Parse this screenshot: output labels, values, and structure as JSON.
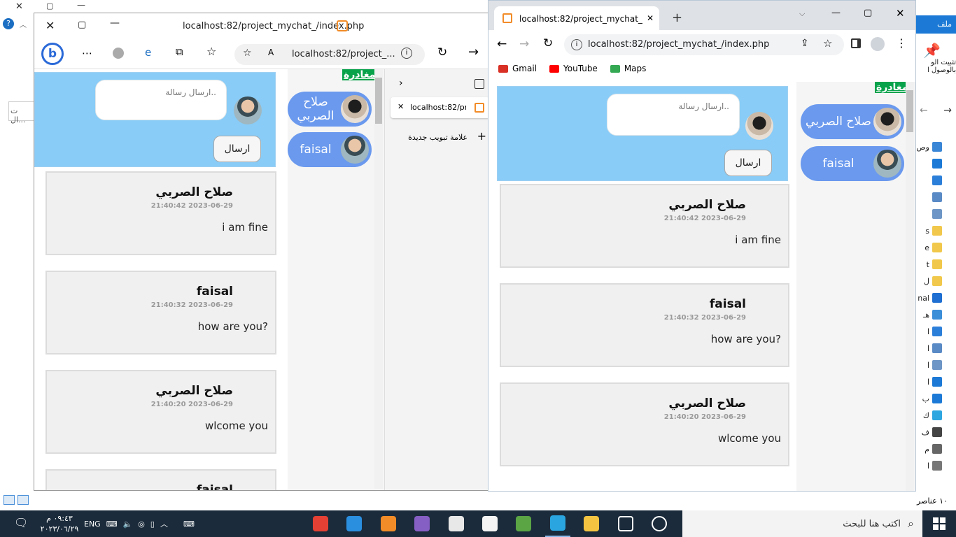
{
  "explorer": {
    "ribbon_label": "ملف",
    "pin_label_1": "تثبيت الو",
    "pin_label_2": "بالوصول ا",
    "search_text": "ت ال...",
    "help_glyph": "?",
    "items_count": "١٠ عناصر",
    "items": [
      {
        "label": "وص",
        "color": "#3a86d6"
      },
      {
        "label": "",
        "color": "#1c7ad6"
      },
      {
        "label": "",
        "color": "#2c7fd9"
      },
      {
        "label": "",
        "color": "#5a8ac5"
      },
      {
        "label": "",
        "color": "#6d95c5"
      },
      {
        "label": "s",
        "color": "#f1c84b"
      },
      {
        "label": "e",
        "color": "#f1c84b"
      },
      {
        "label": "t",
        "color": "#f1c84b"
      },
      {
        "label": "ل",
        "color": "#f1c84b"
      },
      {
        "label": "nal",
        "color": "#1e6fd1"
      },
      {
        "label": "هـ",
        "color": "#3b8ed8"
      },
      {
        "label": "ا",
        "color": "#2c7fd9"
      },
      {
        "label": "ا",
        "color": "#5a8ac5"
      },
      {
        "label": "ا",
        "color": "#6d95c5"
      },
      {
        "label": "ا",
        "color": "#1c7ad6"
      },
      {
        "label": "ب",
        "color": "#1c7ad6"
      },
      {
        "label": "ك",
        "color": "#2ea6e0"
      },
      {
        "label": "ف",
        "color": "#444444"
      },
      {
        "label": "م",
        "color": "#666666"
      },
      {
        "label": "ا",
        "color": "#777777"
      }
    ]
  },
  "taskbar": {
    "search_placeholder": "اكتب هنا للبحث",
    "clock_time": "٠٩:٤٣ م",
    "clock_date": "٢٠٢٣/٠٦/٢٩",
    "lang": "ENG",
    "apps": [
      {
        "name": "chrome",
        "color": "#e44134"
      },
      {
        "name": "vscode",
        "color": "#2b8fe0"
      },
      {
        "name": "xampp",
        "color": "#f28c28"
      },
      {
        "name": "visual-studio",
        "color": "#865fc5"
      },
      {
        "name": "mail",
        "color": "#e8e8e8"
      },
      {
        "name": "store",
        "color": "#f4f4f4"
      },
      {
        "name": "project",
        "color": "#5ba545"
      },
      {
        "name": "edge",
        "color": "#2aa5e0"
      },
      {
        "name": "file-explorer",
        "color": "#f5c542"
      },
      {
        "name": "task-view",
        "color": "#ffffff"
      },
      {
        "name": "cortana",
        "color": "#ffffff"
      }
    ]
  },
  "edge": {
    "tab_title": "localhost:82/project_mychat_/index.php",
    "address": "localhost:82/project_...",
    "vertical_tab_title": "localhost:82/pr",
    "new_tab_label": "علامة تبويب جديدة",
    "chat": {
      "placeholder": "ارسال رسالة..",
      "send_label": "ارسال",
      "leave_label": "مغادرة",
      "users": [
        {
          "name": "صلاح الصربي",
          "avatar": "dark"
        },
        {
          "name": "faisal",
          "avatar": "light"
        }
      ],
      "messages": [
        {
          "name": "صلاح الصربي",
          "time": "2023-06-29 21:40:42",
          "text": "i am fine"
        },
        {
          "name": "faisal",
          "time": "2023-06-29 21:40:32",
          "text": "how are you?"
        },
        {
          "name": "صلاح الصربي",
          "time": "2023-06-29 21:40:20",
          "text": "wlcome you"
        },
        {
          "name": "faisal",
          "time": "",
          "text": ""
        }
      ]
    }
  },
  "chrome": {
    "tab_title": "localhost:82/project_mychat_/ind",
    "address": "localhost:82/project_mychat_/index.php",
    "bookmarks": [
      {
        "label": "Gmail",
        "color": "#d93025"
      },
      {
        "label": "YouTube",
        "color": "#ff0000"
      },
      {
        "label": "Maps",
        "color": "#34a853"
      }
    ],
    "chat": {
      "placeholder": "ارسال رسالة..",
      "send_label": "ارسال",
      "leave_label": "مغادرة",
      "users": [
        {
          "name": "صلاح الصربي",
          "avatar": "dark"
        },
        {
          "name": "faisal",
          "avatar": "light"
        }
      ],
      "messages": [
        {
          "name": "صلاح الصربي",
          "time": "2023-06-29 21:40:42",
          "text": "i am fine"
        },
        {
          "name": "faisal",
          "time": "2023-06-29 21:40:32",
          "text": "how are you?"
        },
        {
          "name": "صلاح الصربي",
          "time": "2023-06-29 21:40:20",
          "text": "wlcome you"
        }
      ]
    }
  }
}
